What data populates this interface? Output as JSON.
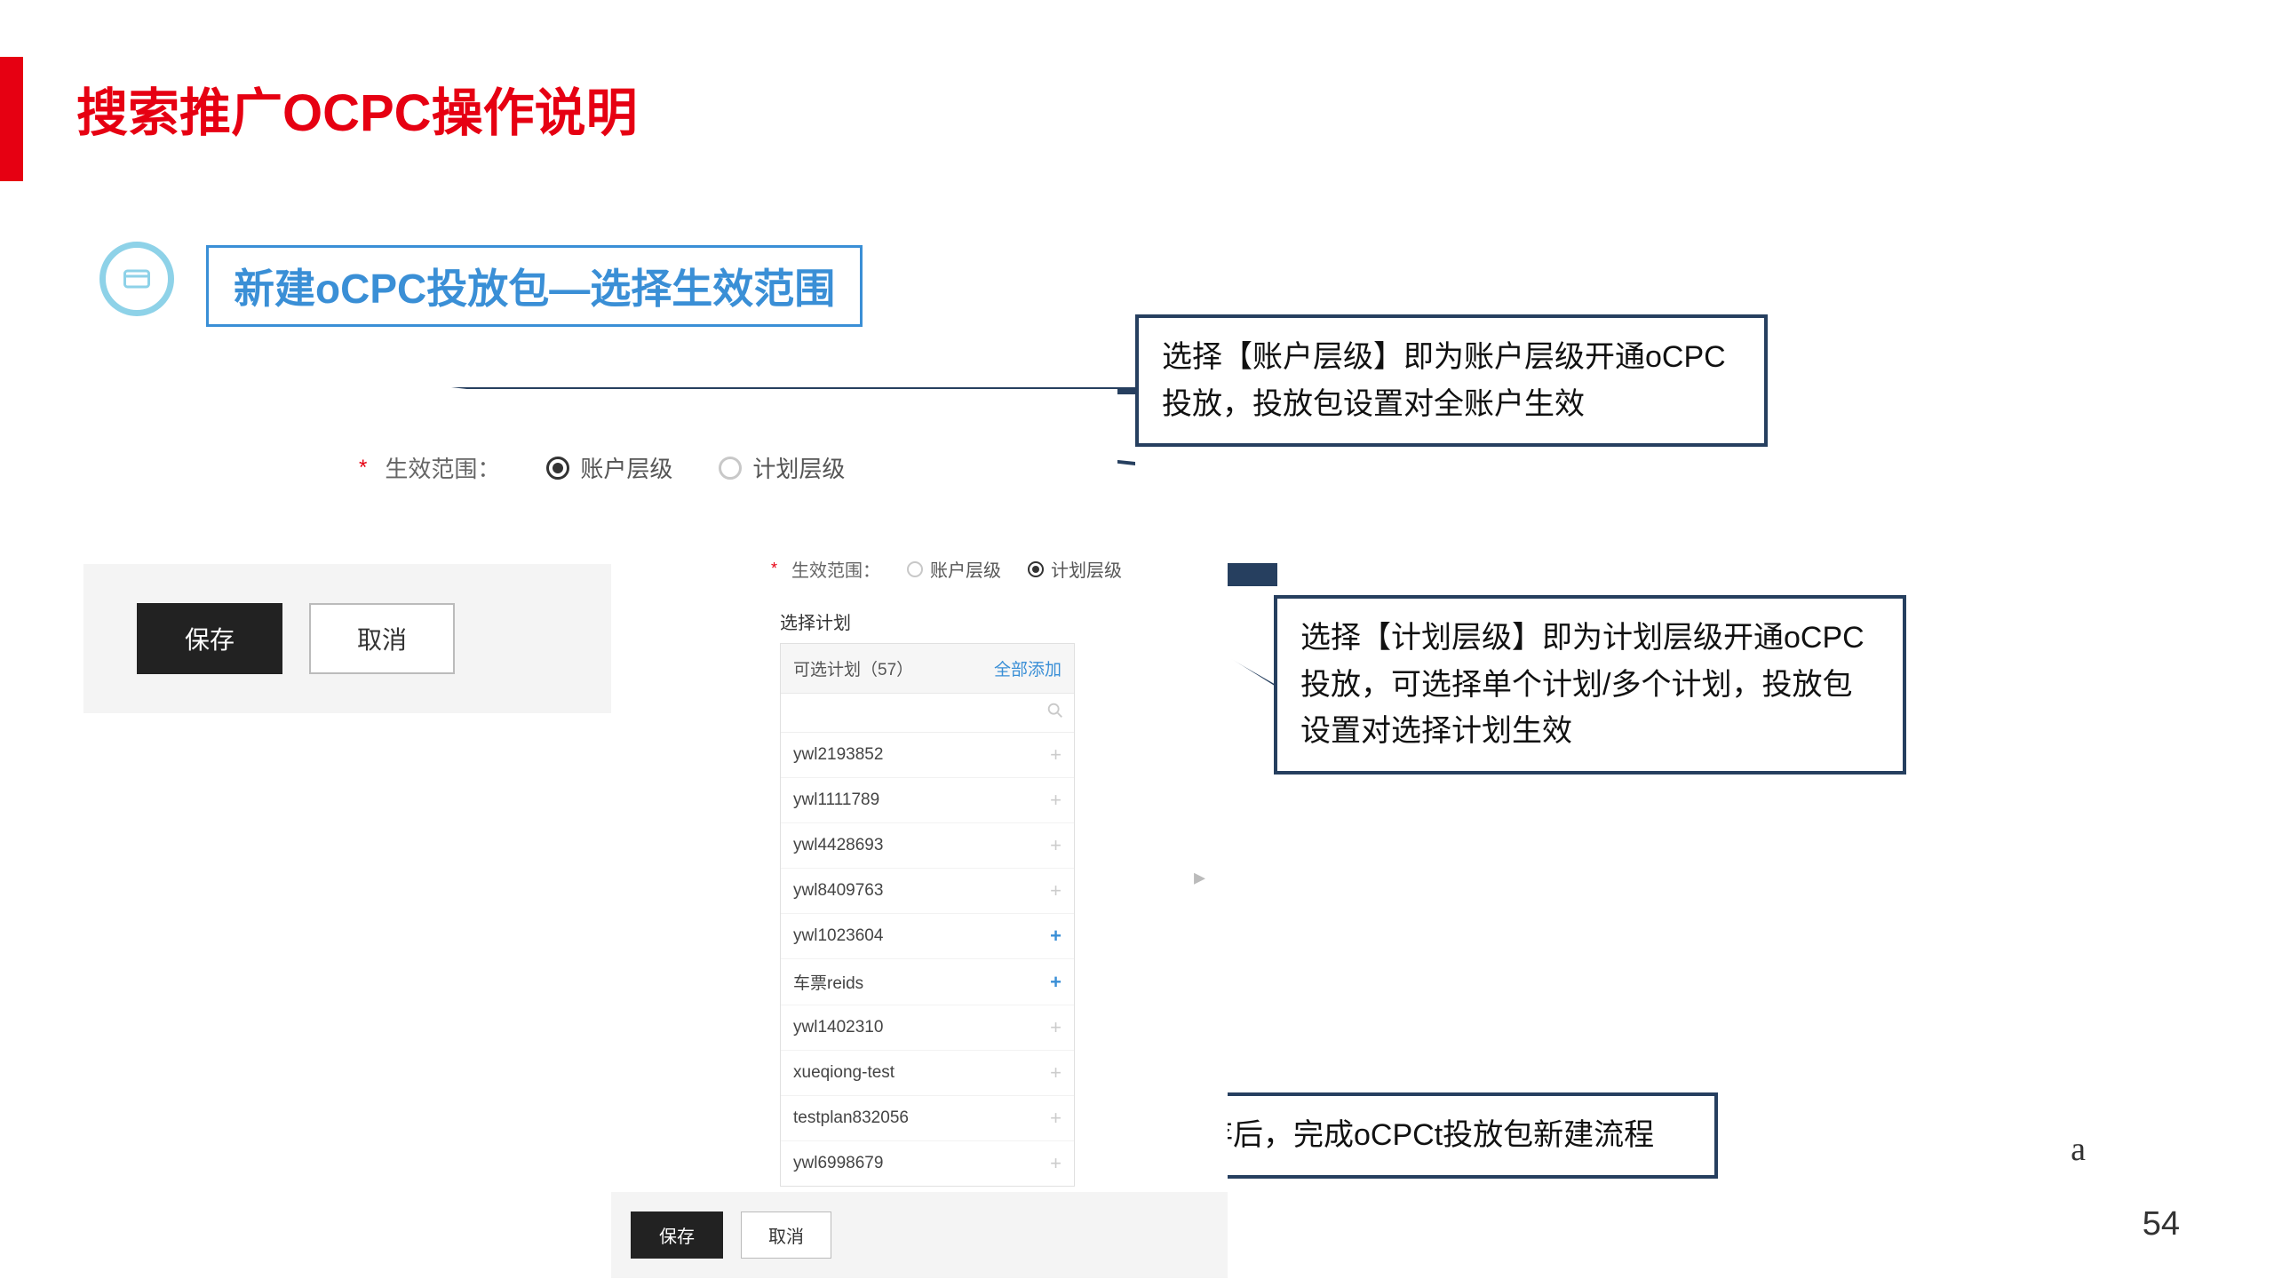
{
  "title": "搜索推广OCPC操作说明",
  "subtitle": "新建oCPC投放包—选择生效范围",
  "callouts": {
    "c1": "选择【账户层级】即为账户层级开通oCPC投放，投放包设置对全账户生效",
    "c2": "选择【计划层级】即为计划层级开通oCPC投放，可选择单个计划/多个计划，投放包设置对选择计划生效",
    "c3": "点击保存后，完成oCPCt投放包新建流程"
  },
  "panel1": {
    "scope_label": "生效范围：",
    "opt_account": "账户层级",
    "opt_plan": "计划层级",
    "save": "保存",
    "cancel": "取消"
  },
  "panel2": {
    "scope_label": "生效范围：",
    "opt_account": "账户层级",
    "opt_plan": "计划层级",
    "select_plan": "选择计划",
    "available_plans": "可选计划（57）",
    "add_all": "全部添加",
    "plans": [
      "ywl2193852",
      "ywl1111789",
      "ywl4428693",
      "ywl8409763",
      "ywl1023604",
      "车票reids",
      "ywl1402310",
      "xueqiong-test",
      "testplan832056",
      "ywl6998679"
    ],
    "save": "保存",
    "cancel": "取消"
  },
  "extras": {
    "a": "a",
    "page": "54"
  }
}
